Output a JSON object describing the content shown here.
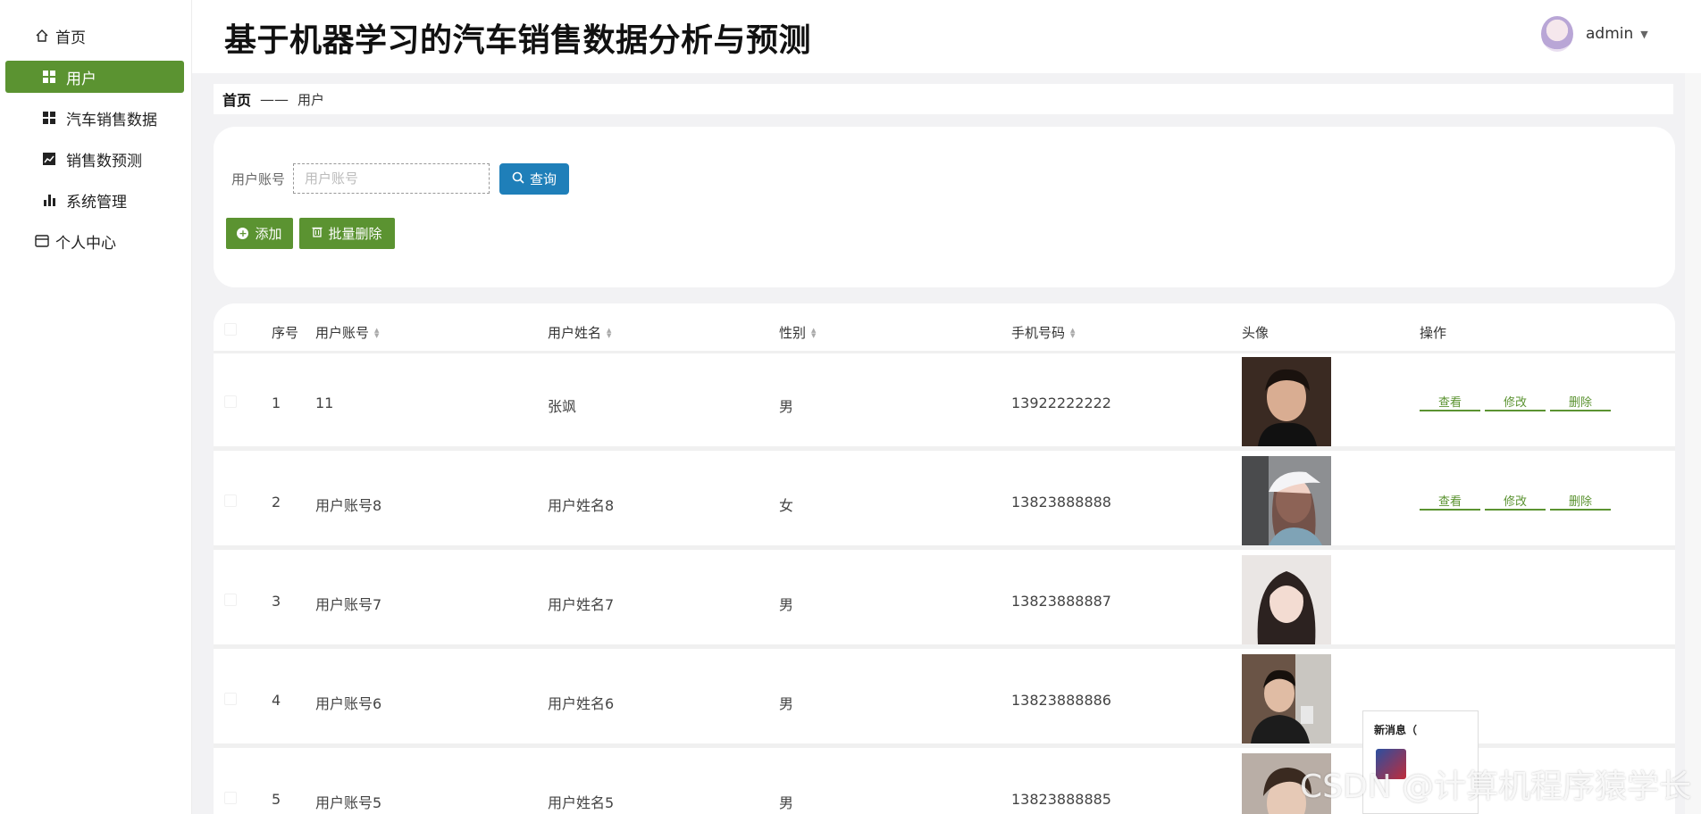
{
  "app": {
    "title": "基于机器学习的汽车销售数据分析与预测"
  },
  "header": {
    "username": "admin",
    "caret": "▼"
  },
  "sidebar": {
    "items": [
      {
        "label": "首页",
        "icon": "home-icon"
      },
      {
        "label": "用户",
        "icon": "grid-icon",
        "active": true
      },
      {
        "label": "汽车销售数据",
        "icon": "grid-icon"
      },
      {
        "label": "销售数预测",
        "icon": "chart-icon"
      },
      {
        "label": "系统管理",
        "icon": "bar-chart-icon"
      },
      {
        "label": "个人中心",
        "icon": "card-icon"
      }
    ]
  },
  "breadcrumb": {
    "home": "首页",
    "separator": "——",
    "current": "用户"
  },
  "search": {
    "label": "用户账号",
    "placeholder": "用户账号",
    "query_label": "查询",
    "add_label": "添加",
    "batch_delete_label": "批量删除"
  },
  "table": {
    "headers": {
      "index": "序号",
      "account": "用户账号",
      "name": "用户姓名",
      "gender": "性别",
      "phone": "手机号码",
      "avatar": "头像",
      "actions": "操作"
    },
    "action_labels": {
      "view": "查看",
      "edit": "修改",
      "delete": "删除"
    },
    "rows": [
      {
        "index": "1",
        "account": "11",
        "name": "张飒",
        "gender": "男",
        "phone": "13922222222"
      },
      {
        "index": "2",
        "account": "用户账号8",
        "name": "用户姓名8",
        "gender": "女",
        "phone": "13823888888"
      },
      {
        "index": "3",
        "account": "用户账号7",
        "name": "用户姓名7",
        "gender": "男",
        "phone": "13823888887"
      },
      {
        "index": "4",
        "account": "用户账号6",
        "name": "用户姓名6",
        "gender": "男",
        "phone": "13823888886"
      },
      {
        "index": "5",
        "account": "用户账号5",
        "name": "用户姓名5",
        "gender": "男",
        "phone": "13823888885"
      }
    ]
  },
  "notification": {
    "title": "新消息（"
  },
  "watermark": "CSDN @计算机程序猿学长",
  "colors": {
    "primary_green": "#5b9331",
    "query_blue": "#1f7fb9"
  }
}
